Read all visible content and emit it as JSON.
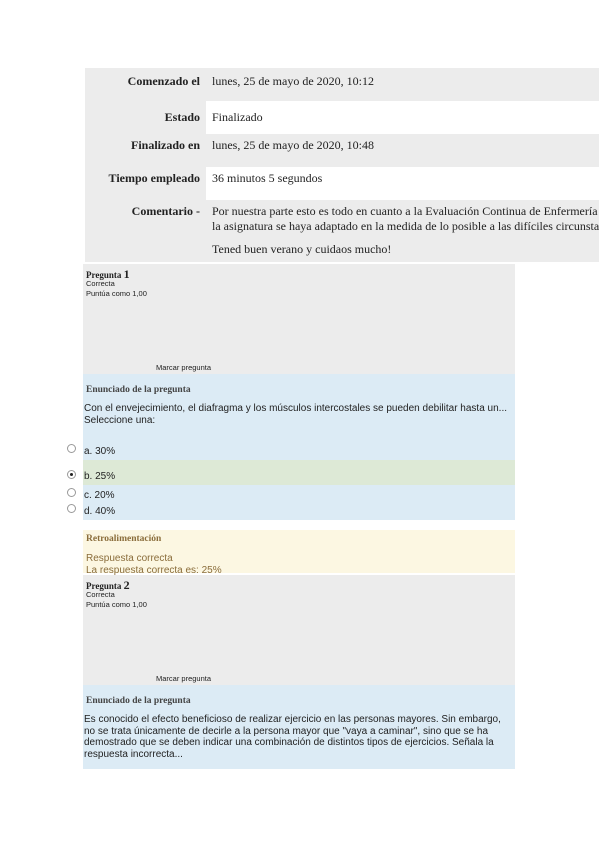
{
  "summary": {
    "started_label": "Comenzado el",
    "started_value": "lunes, 25 de mayo de 2020, 10:12",
    "state_label": "Estado",
    "state_value": "Finalizado",
    "finished_label": "Finalizado en",
    "finished_value": "lunes, 25 de mayo de 2020, 10:48",
    "time_label": "Tiempo empleado",
    "time_value": "36 minutos 5 segundos",
    "comment_label": "Comentario -",
    "comment_line1": "Por nuestra parte esto es todo en cuanto a la Evaluación Continua de Enfermería",
    "comment_line2": "la asignatura se haya adaptado en la medida de lo posible a las difíciles circunsta",
    "comment_line3": "Tened buen verano y cuidaos mucho!"
  },
  "q1": {
    "label": "Pregunta",
    "number": "1",
    "state": "Correcta",
    "grade": "Puntúa como 1,00",
    "flag": "Marcar pregunta",
    "header": "Enunciado de la pregunta",
    "text": "Con el envejecimiento, el diafragma y los músculos intercostales se pueden debilitar hasta un...",
    "prompt": "Seleccione una:",
    "options": [
      "a. 30%",
      "b. 25%",
      "c. 20%",
      "d. 40%"
    ],
    "selected": "b. 25%"
  },
  "feedback": {
    "header": "Retroalimentación",
    "line1": "Respuesta correcta",
    "line2": "La respuesta correcta es: 25%"
  },
  "q2": {
    "label": "Pregunta",
    "number": "2",
    "state": "Correcta",
    "grade": "Puntúa como 1,00",
    "flag": "Marcar pregunta",
    "header": "Enunciado de la pregunta",
    "text": "Es conocido el efecto beneficioso de realizar ejercicio en las personas mayores. Sin embargo, no se trata únicamente de decirle a la persona mayor que \"vaya a caminar\", sino que se ha demostrado que se deben indicar una combinación de distintos tipos de ejercicios. Señala la respuesta incorrecta..."
  }
}
